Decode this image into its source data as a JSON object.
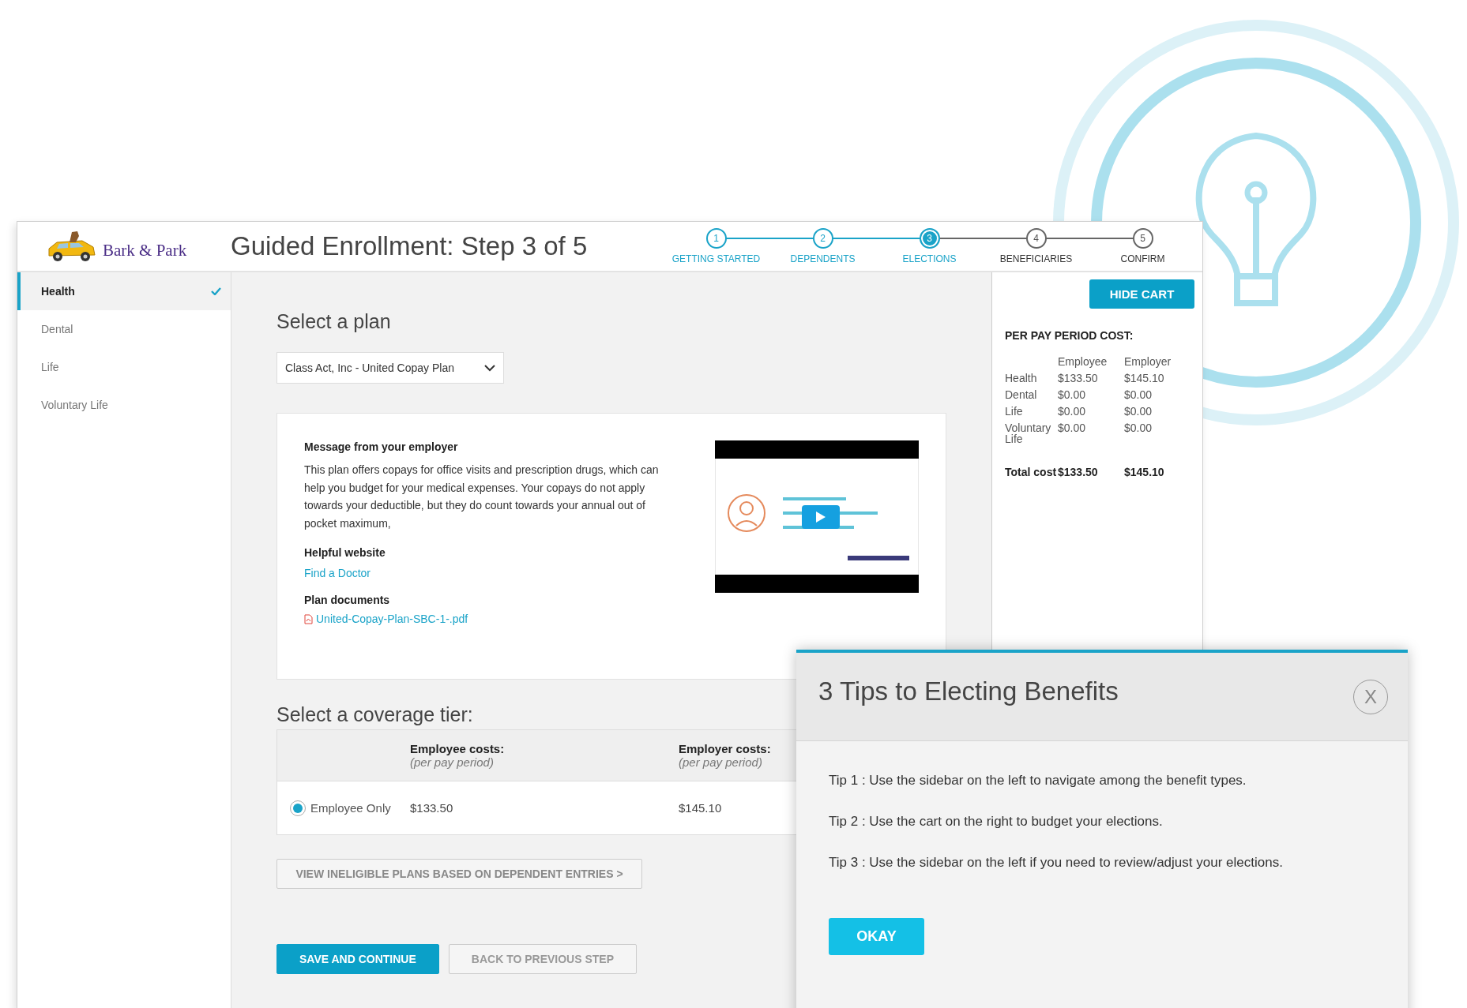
{
  "logo": {
    "text": "Bark & Park"
  },
  "title": "Guided Enrollment: Step 3 of 5",
  "steps": [
    {
      "number": "1",
      "label": "GETTING STARTED",
      "completed": true,
      "selected": false
    },
    {
      "number": "2",
      "label": "DEPENDENTS",
      "completed": true,
      "selected": false
    },
    {
      "number": "3",
      "label": "ELECTIONS",
      "completed": false,
      "selected": true
    },
    {
      "number": "4",
      "label": "BENEFICIARIES",
      "completed": false,
      "selected": false
    },
    {
      "number": "5",
      "label": "CONFIRM",
      "completed": false,
      "selected": false
    }
  ],
  "sidebar": {
    "items": [
      {
        "label": "Health",
        "selected": true,
        "completed": true
      },
      {
        "label": "Dental",
        "selected": false,
        "completed": false
      },
      {
        "label": "Life",
        "selected": false,
        "completed": false
      },
      {
        "label": "Voluntary Life",
        "selected": false,
        "completed": false
      }
    ]
  },
  "plan": {
    "heading": "Select a plan",
    "dropdown": {
      "value": "Class Act, Inc - United Copay Plan"
    },
    "message_heading": "Message from your employer",
    "message": "This plan offers copays for office visits and prescription drugs, which can help you budget for your medical expenses. Your copays do not apply towards your deductible, but they do count towards your annual out of pocket maximum,",
    "website_heading": "Helpful website",
    "website_link": "Find a Doctor",
    "documents_heading": "Plan documents",
    "document_link": "United-Copay-Plan-SBC-1-.pdf"
  },
  "coverage": {
    "heading": "Select a coverage tier:",
    "columns": [
      {
        "title": "Employee costs:",
        "note": "(per pay period)"
      },
      {
        "title": "Employer costs:",
        "note": "(per pay period)"
      }
    ],
    "rows": [
      {
        "label": "Employee Only",
        "selected": true,
        "employee": "$133.50",
        "employer": "$145.10"
      }
    ]
  },
  "ineligible_button": "VIEW INELIGIBLE PLANS BASED ON DEPENDENT ENTRIES >",
  "buttons": [
    {
      "label": "SAVE AND CONTINUE",
      "kind": "primary"
    },
    {
      "label": "BACK TO PREVIOUS STEP",
      "kind": "secondary"
    }
  ],
  "cart": {
    "hide_button": "HIDE CART",
    "heading": "PER PAY PERIOD COST:",
    "columns": [
      "Employee",
      "Employer"
    ],
    "rows": [
      {
        "label": "Health",
        "employee": "$133.50",
        "employer": "$145.10"
      },
      {
        "label": "Dental",
        "employee": "$0.00",
        "employer": "$0.00"
      },
      {
        "label": "Life",
        "employee": "$0.00",
        "employer": "$0.00"
      },
      {
        "label": "Voluntary Life",
        "employee": "$0.00",
        "employer": "$0.00"
      }
    ],
    "total": {
      "label": "Total cost",
      "employee": "$133.50",
      "employer": "$145.10"
    }
  },
  "modal": {
    "title": "3 Tips to Electing Benefits",
    "close": "X",
    "tips": [
      "Tip 1 : Use the sidebar on the left to navigate among the benefit types.",
      "Tip 2 : Use the cart on the right to budget your elections.",
      "Tip 3 : Use the sidebar on the left if you need to review/adjust your elections."
    ],
    "button": "OKAY"
  }
}
